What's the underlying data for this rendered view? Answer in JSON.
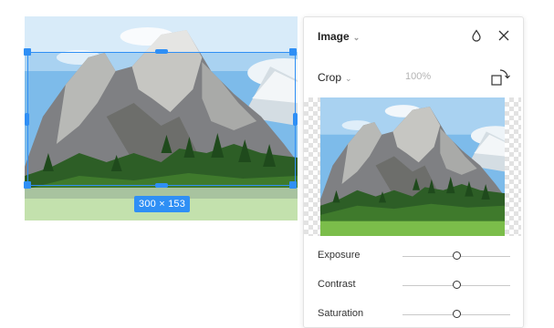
{
  "canvas": {
    "size_label": "300 × 153"
  },
  "panel": {
    "title": "Image",
    "crop_label": "Crop",
    "zoom_value": "100%",
    "adjustments": [
      {
        "label": "Exposure",
        "value": 0.5
      },
      {
        "label": "Contrast",
        "value": 0.5
      },
      {
        "label": "Saturation",
        "value": 0.5
      }
    ]
  },
  "colors": {
    "accent": "#2f8ff5"
  }
}
